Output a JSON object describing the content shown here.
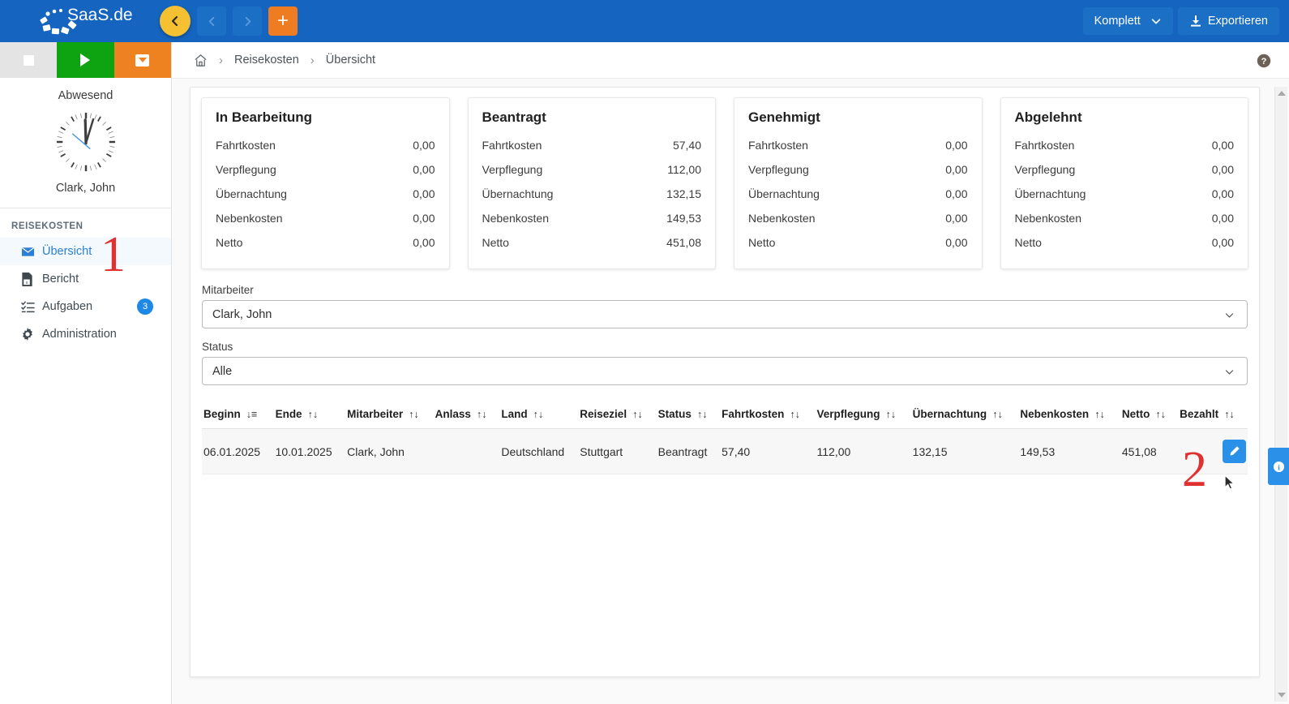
{
  "app": {
    "brand": "SaaS.de",
    "accent_blue": "#1565c0",
    "accent_orange": "#ef7c20",
    "accent_yellow": "#f5c031",
    "accent_green": "#0ea311",
    "link_blue": "#2b7fd4"
  },
  "topbar": {
    "back_icon": "chevron-left-icon",
    "prev_icon": "chevron-left-icon",
    "next_icon": "chevron-right-icon",
    "add_icon": "plus-icon",
    "scope_label": "Komplett",
    "scope_chevron": "chevron-down-icon",
    "export_label": "Exportieren",
    "export_icon": "download-icon"
  },
  "sidebar": {
    "status_buttons": [
      {
        "name": "stop-button",
        "icon": "square-icon"
      },
      {
        "name": "start-button",
        "icon": "play-icon"
      },
      {
        "name": "pause-dropdown-button",
        "icon": "caret-down-icon"
      }
    ],
    "presence": "Abwesend",
    "clock_icon": "analog-clock-icon",
    "user": "Clark, John",
    "section_title": "REISEKOSTEN",
    "items": [
      {
        "label": "Übersicht",
        "icon": "envelope-icon",
        "active": true,
        "badge": ""
      },
      {
        "label": "Bericht",
        "icon": "file-excel-icon",
        "active": false,
        "badge": ""
      },
      {
        "label": "Aufgaben",
        "icon": "task-list-icon",
        "active": false,
        "badge": "3"
      },
      {
        "label": "Administration",
        "icon": "gear-icon",
        "active": false,
        "badge": ""
      }
    ]
  },
  "breadcrumb": {
    "home_icon": "home-icon",
    "sep": "›",
    "items": [
      "Reisekosten",
      "Übersicht"
    ],
    "help_icon": "help-circle-icon"
  },
  "cards": [
    {
      "title": "In Bearbeitung",
      "rows": [
        {
          "label": "Fahrtkosten",
          "value": "0,00"
        },
        {
          "label": "Verpflegung",
          "value": "0,00"
        },
        {
          "label": "Übernachtung",
          "value": "0,00"
        },
        {
          "label": "Nebenkosten",
          "value": "0,00"
        },
        {
          "label": "Netto",
          "value": "0,00"
        }
      ]
    },
    {
      "title": "Beantragt",
      "rows": [
        {
          "label": "Fahrtkosten",
          "value": "57,40"
        },
        {
          "label": "Verpflegung",
          "value": "112,00"
        },
        {
          "label": "Übernachtung",
          "value": "132,15"
        },
        {
          "label": "Nebenkosten",
          "value": "149,53"
        },
        {
          "label": "Netto",
          "value": "451,08"
        }
      ]
    },
    {
      "title": "Genehmigt",
      "rows": [
        {
          "label": "Fahrtkosten",
          "value": "0,00"
        },
        {
          "label": "Verpflegung",
          "value": "0,00"
        },
        {
          "label": "Übernachtung",
          "value": "0,00"
        },
        {
          "label": "Nebenkosten",
          "value": "0,00"
        },
        {
          "label": "Netto",
          "value": "0,00"
        }
      ]
    },
    {
      "title": "Abgelehnt",
      "rows": [
        {
          "label": "Fahrtkosten",
          "value": "0,00"
        },
        {
          "label": "Verpflegung",
          "value": "0,00"
        },
        {
          "label": "Übernachtung",
          "value": "0,00"
        },
        {
          "label": "Nebenkosten",
          "value": "0,00"
        },
        {
          "label": "Netto",
          "value": "0,00"
        }
      ]
    }
  ],
  "filters": {
    "employee": {
      "label": "Mitarbeiter",
      "value": "Clark, John",
      "chevron": "chevron-down-icon"
    },
    "status": {
      "label": "Status",
      "value": "Alle",
      "chevron": "chevron-down-icon"
    }
  },
  "table": {
    "columns": [
      {
        "label": "Beginn",
        "sort": "sort-desc-active-icon",
        "sorted": true
      },
      {
        "label": "Ende",
        "sort": "sort-both-icon",
        "sorted": false
      },
      {
        "label": "Mitarbeiter",
        "sort": "sort-both-icon",
        "sorted": false
      },
      {
        "label": "Anlass",
        "sort": "sort-both-icon",
        "sorted": false
      },
      {
        "label": "Land",
        "sort": "sort-both-icon",
        "sorted": false
      },
      {
        "label": "Reiseziel",
        "sort": "sort-both-icon",
        "sorted": false
      },
      {
        "label": "Status",
        "sort": "sort-both-icon",
        "sorted": false
      },
      {
        "label": "Fahrtkosten",
        "sort": "sort-both-icon",
        "sorted": false
      },
      {
        "label": "Verpflegung",
        "sort": "sort-both-icon",
        "sorted": false
      },
      {
        "label": "Übernachtung",
        "sort": "sort-both-icon",
        "sorted": false
      },
      {
        "label": "Nebenkosten",
        "sort": "sort-both-icon",
        "sorted": false
      },
      {
        "label": "Netto",
        "sort": "sort-both-icon",
        "sorted": false
      },
      {
        "label": "Bezahlt",
        "sort": "sort-both-icon",
        "sorted": false
      }
    ],
    "rows": [
      {
        "beginn": "06.01.2025",
        "ende": "10.01.2025",
        "mitarbeiter": "Clark, John",
        "anlass": "",
        "land": "Deutschland",
        "reiseziel": "Stuttgart",
        "status": "Beantragt",
        "fahrtkosten": "57,40",
        "verpflegung": "112,00",
        "uebernachtung": "132,15",
        "nebenkosten": "149,53",
        "netto": "451,08",
        "bezahlt": "",
        "edit_icon": "pencil-icon"
      }
    ]
  },
  "info_tab": {
    "icon": "info-circle-icon"
  },
  "scrollbar": {
    "up_icon": "triangle-up-icon",
    "down_icon": "triangle-down-icon"
  },
  "annotations": [
    {
      "text": "1",
      "target": "sidebar-item-uebersicht"
    },
    {
      "text": "2",
      "target": "row-edit-button"
    }
  ]
}
